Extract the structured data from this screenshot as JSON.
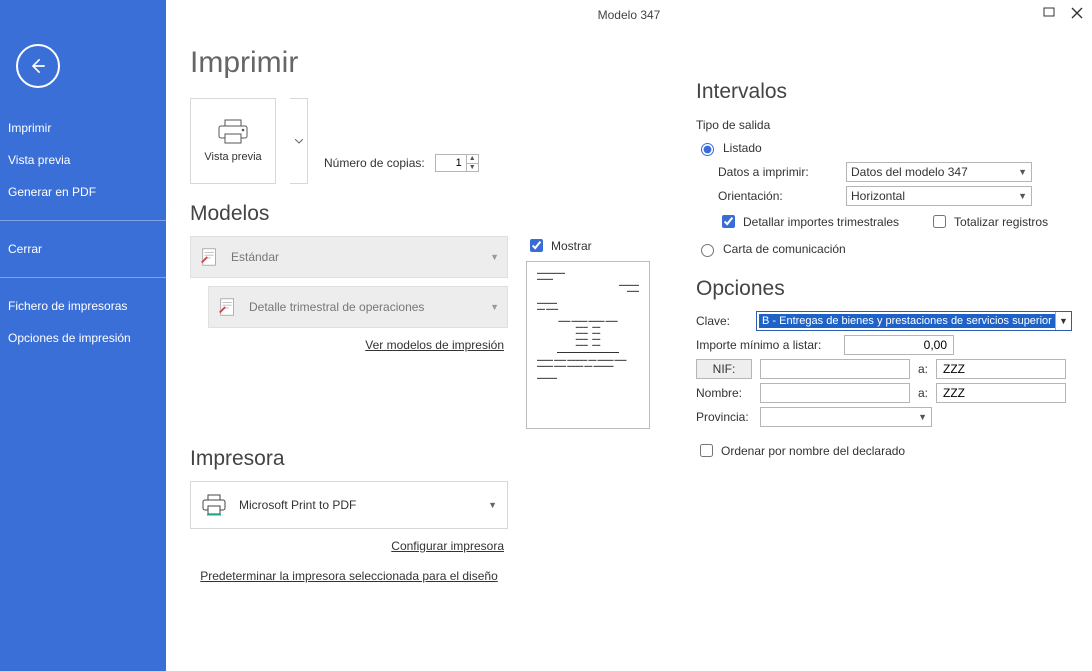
{
  "title": "Modelo 347",
  "sidebar": {
    "imprimir": "Imprimir",
    "vista_previa": "Vista previa",
    "generar_pdf": "Generar en PDF",
    "cerrar": "Cerrar",
    "fichero": "Fichero de impresoras",
    "opciones": "Opciones de impresión"
  },
  "main": {
    "heading": "Imprimir",
    "vista_previa_label": "Vista previa",
    "copias_label": "Número de copias:",
    "copias_value": "1",
    "modelos_heading": "Modelos",
    "mostrar_label": "Mostrar",
    "modelo_estandar": "Estándar",
    "modelo_detalle": "Detalle trimestral de operaciones",
    "ver_modelos": "Ver modelos de impresión",
    "impresora_heading": "Impresora",
    "printer_name": "Microsoft Print to PDF",
    "configurar": "Configurar impresora",
    "predeterminar": "Predeterminar la impresora seleccionada para el diseño"
  },
  "intervals": {
    "heading": "Intervalos",
    "tipo_salida": "Tipo de salida",
    "listado": "Listado",
    "datos_label": "Datos a imprimir:",
    "datos_value": "Datos del modelo 347",
    "orient_label": "Orientación:",
    "orient_value": "Horizontal",
    "detallar": "Detallar importes trimestrales",
    "totalizar": "Totalizar registros",
    "carta": "Carta de comunicación"
  },
  "opciones": {
    "heading": "Opciones",
    "clave_label": "Clave:",
    "clave_value": "B - Entregas de bienes y prestaciones de servicios superior",
    "importe_label": "Importe mínimo a listar:",
    "importe_value": "0,00",
    "nif_btn": "NIF:",
    "a_label": "a:",
    "zzz": "ZZZ",
    "nombre_label": "Nombre:",
    "provincia_label": "Provincia:",
    "ordenar": "Ordenar por nombre del declarado"
  }
}
